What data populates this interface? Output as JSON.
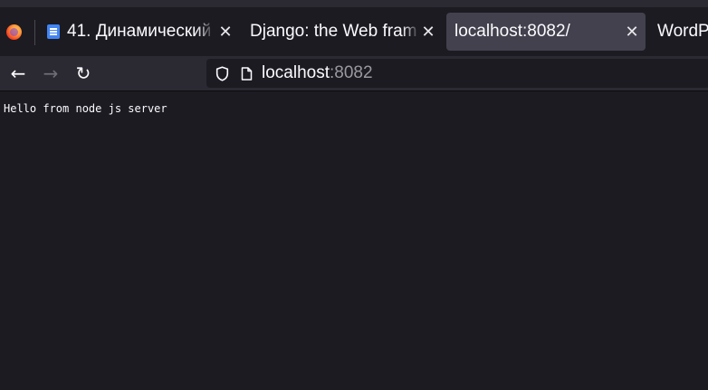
{
  "tabs": [
    {
      "label": "41. Динамический",
      "icon": "google-docs-icon",
      "active": false
    },
    {
      "label": "Django: the Web framework",
      "active": false
    },
    {
      "label": "localhost:8082/",
      "active": true
    },
    {
      "label": "WordPress",
      "active": false
    }
  ],
  "nav": {
    "back_icon": "←",
    "forward_icon": "→",
    "reload_icon": "↻"
  },
  "urlbar": {
    "host": "localhost",
    "port": ":8082"
  },
  "page": {
    "body_text": "Hello from node js server"
  },
  "colors": {
    "background": "#1c1b22",
    "toolbar": "#2b2a33",
    "active_tab": "#42414d",
    "text": "#fbfbfe"
  }
}
